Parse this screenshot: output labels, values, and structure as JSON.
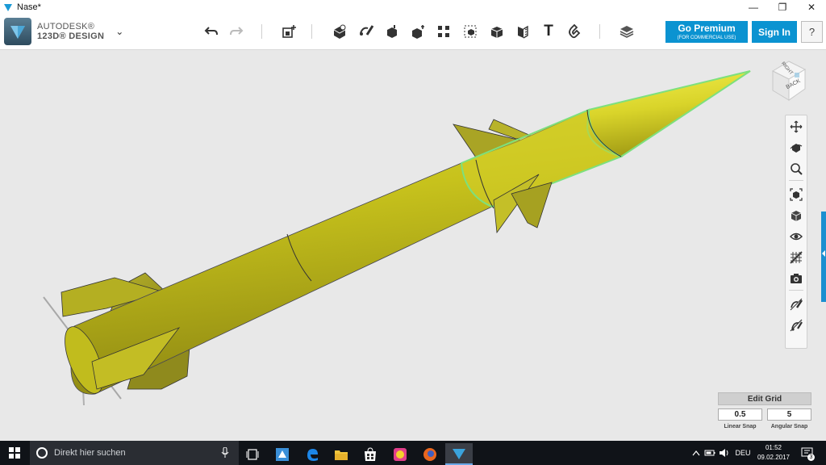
{
  "window": {
    "title": "Nase*",
    "minimize": "—",
    "restore": "❐",
    "close": "✕"
  },
  "brand": {
    "line1": "AUTODESK®",
    "line2": "123D® DESIGN",
    "menu_chevron": "⌄"
  },
  "toolbar": {
    "tools": [
      {
        "name": "undo-icon"
      },
      {
        "name": "redo-icon"
      },
      {
        "name": "transform-icon"
      },
      {
        "name": "primitives-icon"
      },
      {
        "name": "sketch-icon"
      },
      {
        "name": "construct-icon"
      },
      {
        "name": "modify-icon"
      },
      {
        "name": "pattern-icon"
      },
      {
        "name": "grouping-icon"
      },
      {
        "name": "combine-icon"
      },
      {
        "name": "measure-icon"
      },
      {
        "name": "text-icon"
      },
      {
        "name": "snap-icon"
      },
      {
        "name": "material-icon"
      }
    ],
    "text_tool_glyph": "T",
    "premium_label": "Go Premium",
    "premium_sub": "(FOR COMMERCIAL USE)",
    "signin_label": "Sign In",
    "help_label": "?"
  },
  "viewcube": {
    "top_label": "RIGHT",
    "front_label": "BACK"
  },
  "navbar": {
    "items": [
      "pan-icon",
      "orbit-icon",
      "zoom-icon",
      "fit-icon",
      "view-mode-icon",
      "visibility-icon",
      "material-icon",
      "screenshot-icon",
      "hide-sketches-icon",
      "hide-mesh-icon"
    ]
  },
  "grid": {
    "edit_label": "Edit Grid",
    "linear_value": "0.5",
    "angular_value": "5",
    "linear_label": "Linear Snap",
    "angular_label": "Angular Snap"
  },
  "taskbar": {
    "search_placeholder": "Direkt hier suchen",
    "language": "DEU",
    "time": "01:52",
    "date": "09.02.2017",
    "notification_count": "3"
  },
  "colors": {
    "accent": "#0b93d1",
    "rocket": "#c8c41e",
    "selection_glow": "#7de07d"
  }
}
